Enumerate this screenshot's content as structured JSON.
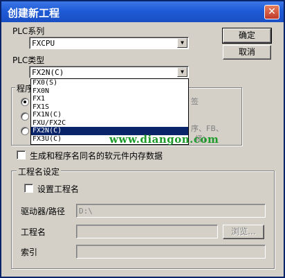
{
  "window": {
    "title": "创建新工程",
    "close_glyph": "✕"
  },
  "plc_series": {
    "label": "PLC系列",
    "value": "FXCPU"
  },
  "plc_type": {
    "label": "PLC类型",
    "value": "FX2N(C)",
    "options": [
      "FX0(S)",
      "FX0N",
      "FX1",
      "FX1S",
      "FX1N(C)",
      "FXU/FX2C",
      "FX2N(C)",
      "FX3U(C)"
    ],
    "selected_index": 6
  },
  "buttons": {
    "ok": "确定",
    "cancel": "取消",
    "browse": "浏览..."
  },
  "program_group": {
    "title_partial": "程序",
    "hidden_right_1": "签",
    "hidden_right_2": "序、FB、",
    "hidden_right_3": "择)"
  },
  "option_generate": {
    "label": "生成和程序名同名的软元件内存数据",
    "checked": false
  },
  "project_name_group": {
    "title": "工程名设定",
    "set_name_label": "设置工程名",
    "set_name_checked": false,
    "drive_label": "驱动器/路径",
    "drive_value": "D:\\",
    "name_label": "工程名",
    "name_value": "",
    "index_label": "索引",
    "index_value": ""
  },
  "watermark": "www.diangon.com",
  "colors": {
    "titlebar": "#1f5bd6",
    "selection": "#0a246a",
    "watermark": "#1d9a2a",
    "face": "#d4d0c8"
  }
}
